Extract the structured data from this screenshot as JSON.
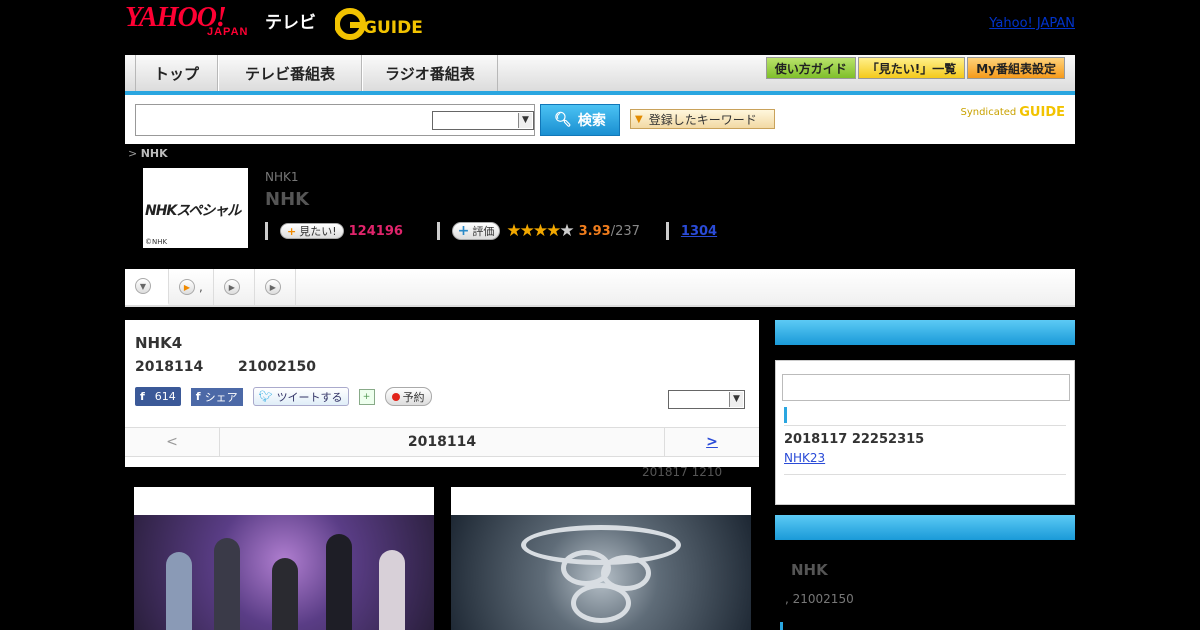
{
  "header": {
    "logo_yahoo": "YAHOO!",
    "logo_japan": "JAPAN",
    "logo_tv": "テレビ",
    "logo_gguide": "GUIDE",
    "yahoo_japan_link": "Yahoo! JAPAN"
  },
  "nav": {
    "tabs": [
      {
        "label": "トップ"
      },
      {
        "label": "テレビ番組表"
      },
      {
        "label": "ラジオ番組表"
      }
    ],
    "guide_button": "使い方ガイド",
    "mitai_list_button": "「見たい!」一覧",
    "my_schedule_button": "My番組表設定"
  },
  "search": {
    "input_value": "",
    "button_label": "検索",
    "keyword_button": "登録したキーワード",
    "syndicated": "Syndicated",
    "syndicated_brand": "GUIDE"
  },
  "breadcrumb": {
    "prefix": ">",
    "current": "NHK"
  },
  "program": {
    "thumb_title": "NHKスペシャル",
    "thumb_copyright": "©NHK",
    "channel": "NHK1",
    "title": "NHK",
    "mitai_label": "見たい!",
    "mitai_count": "124196",
    "eval_label": "評価",
    "score": "3.93",
    "votes": "/237",
    "link_count": "1304",
    "rating_value": 3.93,
    "rating_max": 5
  },
  "subtabs": [
    {
      "label": ""
    },
    {
      "label": ","
    },
    {
      "label": ""
    },
    {
      "label": ""
    }
  ],
  "main": {
    "title": "NHK4",
    "date": "2018114",
    "time": "21002150",
    "fb_like_count": "614",
    "fb_share": "シェア",
    "tweet": "ツイートする",
    "reserve": "予約",
    "pager_prev": "<",
    "pager_current": "2018114",
    "pager_next": ">",
    "updated": "201817  1210"
  },
  "sidebar": {
    "rebroadcast_datetime": "2018117  22252315",
    "rebroadcast_channel": "NHK23",
    "box2_title": "NHK",
    "box2_sub": ", 21002150"
  },
  "colors": {
    "accent_blue": "#2aa6e0",
    "mitai_pink": "#e0246b",
    "score_orange": "#f07d1d",
    "star_gold": "#f2a800",
    "link_blue": "#2a4bd7"
  }
}
